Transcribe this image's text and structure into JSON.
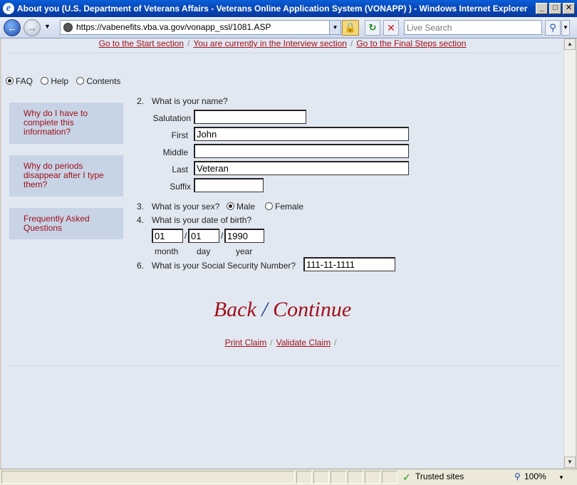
{
  "window": {
    "title": "About you (U.S. Department of Veterans Affairs - Veterans Online Application System (VONAPP) ) - Windows Internet Explorer",
    "min": "_",
    "max": "□",
    "close": "✕"
  },
  "toolbar": {
    "address": "https://vabenefits.vba.va.gov/vonapp_ssl/1081.ASP",
    "search_placeholder": "Live Search"
  },
  "nav": {
    "start": "Go to the Start section",
    "interview": "You are currently in the Interview section",
    "final": "Go to the Final Steps section",
    "sep": "/"
  },
  "sidebar": {
    "radios": [
      {
        "label": "FAQ",
        "checked": true
      },
      {
        "label": "Help",
        "checked": false
      },
      {
        "label": "Contents",
        "checked": false
      }
    ],
    "items": [
      {
        "label": "Why do I have to complete this information?"
      },
      {
        "label": "Why do periods disappear after I type them?"
      },
      {
        "label": "Frequently Asked Questions"
      }
    ]
  },
  "form": {
    "q2": {
      "num": "2.",
      "text": "What is your name?"
    },
    "salutation": {
      "label": "Salutation",
      "value": ""
    },
    "first": {
      "label": "First",
      "value": "John"
    },
    "middle": {
      "label": "Middle",
      "value": ""
    },
    "last": {
      "label": "Last",
      "value": "Veteran"
    },
    "suffix": {
      "label": "Suffix",
      "value": ""
    },
    "q3": {
      "num": "3.",
      "text": "What is your sex?",
      "male": "Male",
      "female": "Female",
      "selected": "Male"
    },
    "q4": {
      "num": "4.",
      "text": "What is your date of birth?"
    },
    "dob": {
      "month": "01",
      "day": "01",
      "year": "1990",
      "month_label": "month",
      "day_label": "day",
      "year_label": "year",
      "sep": "/"
    },
    "q6": {
      "num": "6.",
      "text": "What is your Social Security Number?",
      "value": "111-11-1111"
    }
  },
  "actions": {
    "back": "Back",
    "slash": "/",
    "continue": "Continue",
    "print": "Print Claim",
    "validate": "Validate Claim",
    "sep": "/"
  },
  "status": {
    "zone": "Trusted sites",
    "zoom": "100%"
  }
}
